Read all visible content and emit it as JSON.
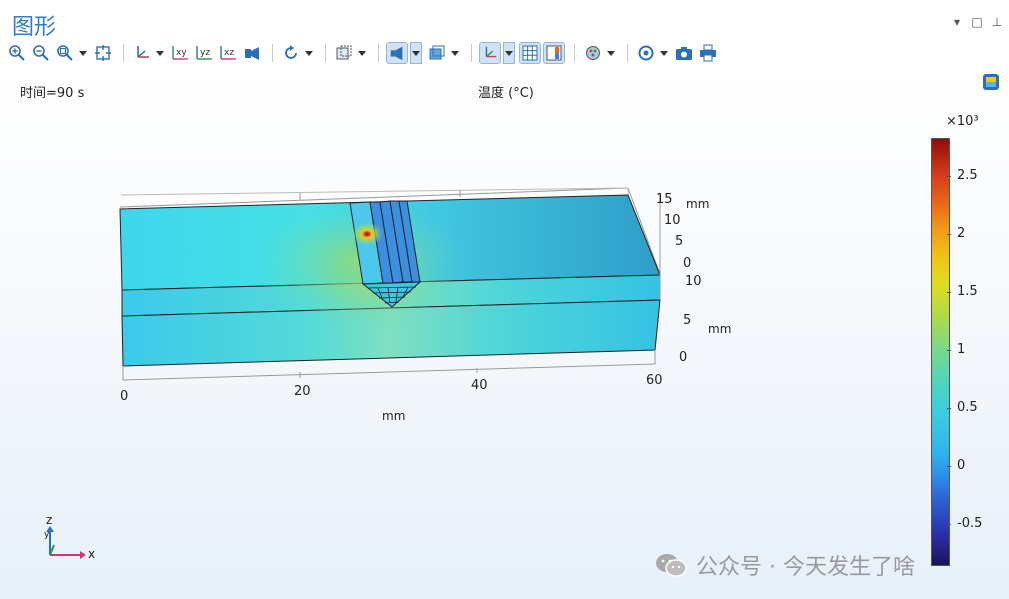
{
  "window": {
    "title": "图形",
    "controls": {
      "menu": "▾",
      "maximize": "□",
      "pin": "⊥"
    }
  },
  "toolbar": {
    "icons": [
      "zoom-in-icon",
      "zoom-out-icon",
      "zoom-box-icon",
      "zoom-extents-icon",
      "axis-orientation-icon",
      "view-xy-icon",
      "view-yz-icon",
      "view-xz-icon",
      "camera-light-icon",
      "rotate-icon",
      "selection-box-icon",
      "headlight-icon",
      "transparency-icon",
      "axis-triad-icon",
      "grid-icon",
      "legend-icon",
      "render-options-icon",
      "scene-light-icon",
      "snapshot-icon",
      "print-icon"
    ],
    "labels": {
      "xy": "xy",
      "yz": "yz",
      "xz": "xz"
    }
  },
  "plot": {
    "time_label": "时间=90 s",
    "quantity_label": "温度 (°C)",
    "x_axis": {
      "unit": "mm",
      "ticks": [
        "0",
        "20",
        "40",
        "60"
      ]
    },
    "y_axis": {
      "unit": "mm",
      "ticks": [
        "15",
        "10",
        "5",
        "0"
      ]
    },
    "z_axis": {
      "unit": "mm",
      "ticks": [
        "10",
        "5",
        "0"
      ]
    },
    "triad": {
      "z": "z",
      "y": "y",
      "x": "x"
    }
  },
  "colorbar": {
    "exponent_label": "×10³",
    "ticks": [
      "2.5",
      "2",
      "1.5",
      "1",
      "0.5",
      "0",
      "-0.5"
    ],
    "colors": {
      "min": "#1b1458",
      "low": "#2f87e4",
      "mid": "#3fd0d6",
      "midhigh": "#bada3c",
      "high": "#f19a16",
      "max": "#8f0c0c"
    }
  },
  "watermark": {
    "text": "公众号 · 今天发生了啥"
  }
}
